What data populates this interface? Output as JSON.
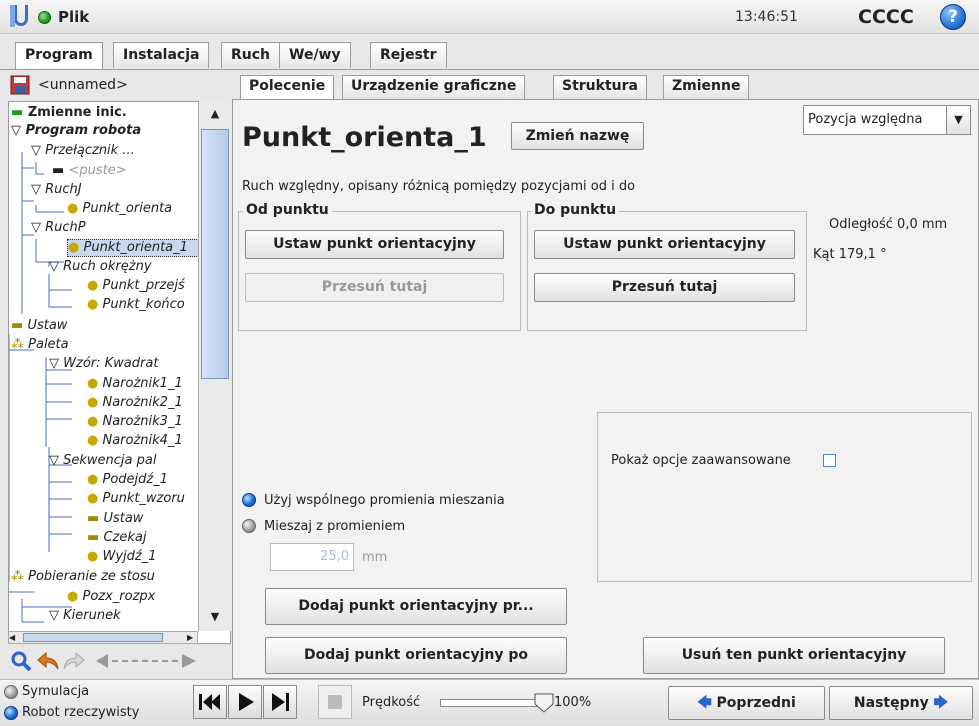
{
  "header": {
    "file_label": "Plik",
    "clock": "13:46:51",
    "robot_name": "CCCC",
    "help_glyph": "?"
  },
  "main_tabs": [
    "Program",
    "Instalacja",
    "Ruch",
    "We/wy",
    "Rejestr"
  ],
  "tree": {
    "program_name": "<unnamed>",
    "nodes": [
      "Zmienne inic.",
      "Program robota",
      "Przełącznik ...",
      "<puste>",
      "RuchJ",
      "Punkt_orienta",
      "RuchP",
      "Punkt_orienta_1",
      "Ruch okrężny",
      "Punkt_przejś",
      "Punkt_końco",
      "Ustaw",
      "Paleta",
      "Wzór: Kwadrat",
      "Narożnik1_1",
      "Narożnik2_1",
      "Narożnik3_1",
      "Narożnik4_1",
      "Sekwencja pal",
      "Podejdź_1",
      "Punkt_wzoru",
      "Ustaw",
      "Czekaj",
      "Wyjdź_1",
      "Pobieranie ze stosu",
      "Pozx_rozpx",
      "Kierunek"
    ]
  },
  "content_tabs": [
    "Polecenie",
    "Urządzenie graficzne",
    "Struktura",
    "Zmienne"
  ],
  "command": {
    "waypoint_name": "Punkt_orienta_1",
    "rename_button": "Zmień nazwę",
    "position_select": "Pozycja względna",
    "description": "Ruch względny, opisany różnicą pomiędzy pozycjami od i do",
    "from_group": "Od punktu",
    "to_group": "Do punktu",
    "set_waypoint": "Ustaw punkt orientacyjny",
    "move_here": "Przesuń tutaj",
    "distance": "Odległość 0,0 mm",
    "angle": "Kąt 179,1 °",
    "advanced_label": "Pokaż opcje zaawansowane",
    "shared_blend": "Użyj wspólnego promienia mieszania",
    "blend_radius": "Mieszaj z promieniem",
    "radius_value": "25,0",
    "radius_unit": "mm",
    "add_before": "Dodaj punkt orientacyjny pr...",
    "add_after": "Dodaj punkt orientacyjny po",
    "delete": "Usuń ten punkt orientacyjny"
  },
  "footer": {
    "simulation": "Symulacja",
    "real_robot": "Robot rzeczywisty",
    "speed_label": "Prędkość",
    "speed_value": "100%",
    "speed_fraction": 1.0,
    "previous": "Poprzedni",
    "next": "Następny"
  },
  "colors": {
    "accent_blue": "#1f6fd8",
    "header_green": "#1e9b1e",
    "selection": "#c9d7ef"
  }
}
